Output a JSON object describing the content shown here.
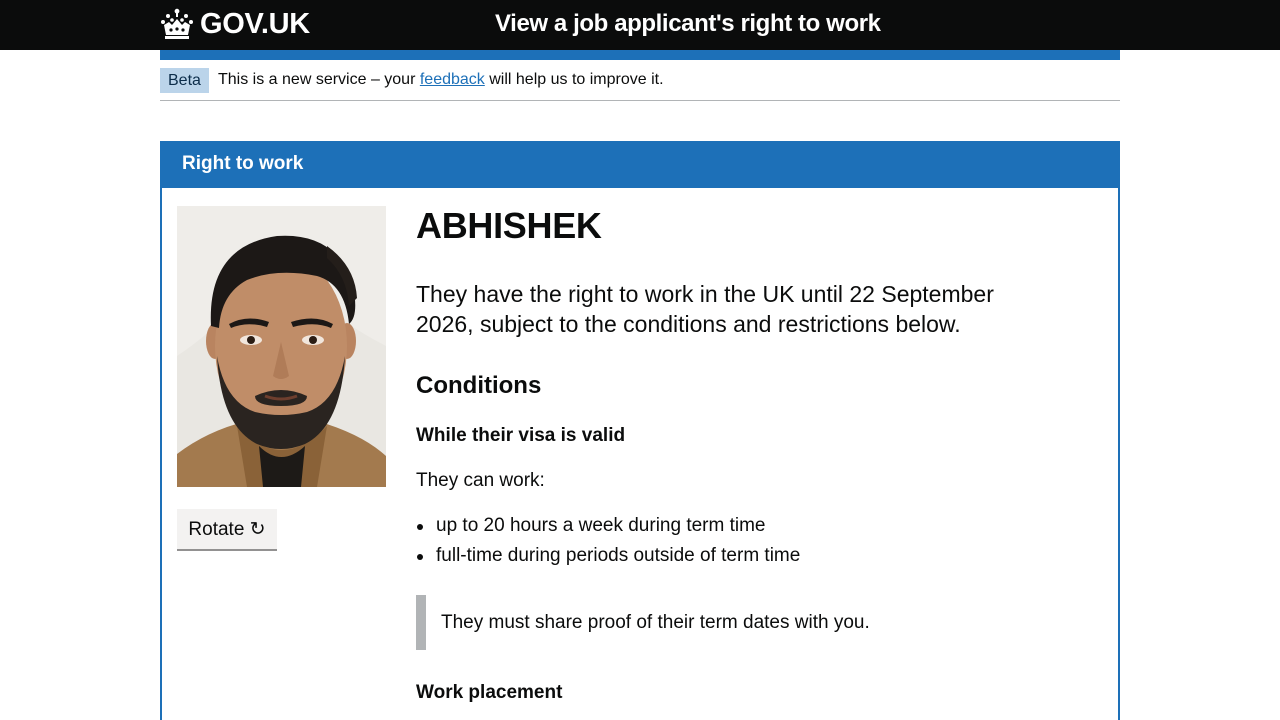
{
  "header": {
    "logo_text": "GOV.UK",
    "service_name": "View a job applicant's right to work"
  },
  "phase_banner": {
    "tag": "Beta",
    "text_before": "This is a new service – your ",
    "link_text": "feedback",
    "text_after": " will help us to improve it."
  },
  "card": {
    "title": "Right to work",
    "rotate_label": "Rotate ↻",
    "name": "ABHISHEK",
    "lead": "They have the right to work in the UK until 22 September 2026, subject to the conditions and restrictions below.",
    "conditions_heading": "Conditions",
    "visa_heading": "While their visa is valid",
    "can_work": "They can work:",
    "work_items": [
      "up to 20 hours a week during term time",
      "full-time during periods outside of term time"
    ],
    "inset": "They must share proof of their term dates with you.",
    "placement_heading": "Work placement"
  },
  "colors": {
    "header_bg": "#0b0c0c",
    "brand_blue": "#1d70b8",
    "tag_bg": "#bbd4ea",
    "inset_border": "#b1b4b6"
  }
}
